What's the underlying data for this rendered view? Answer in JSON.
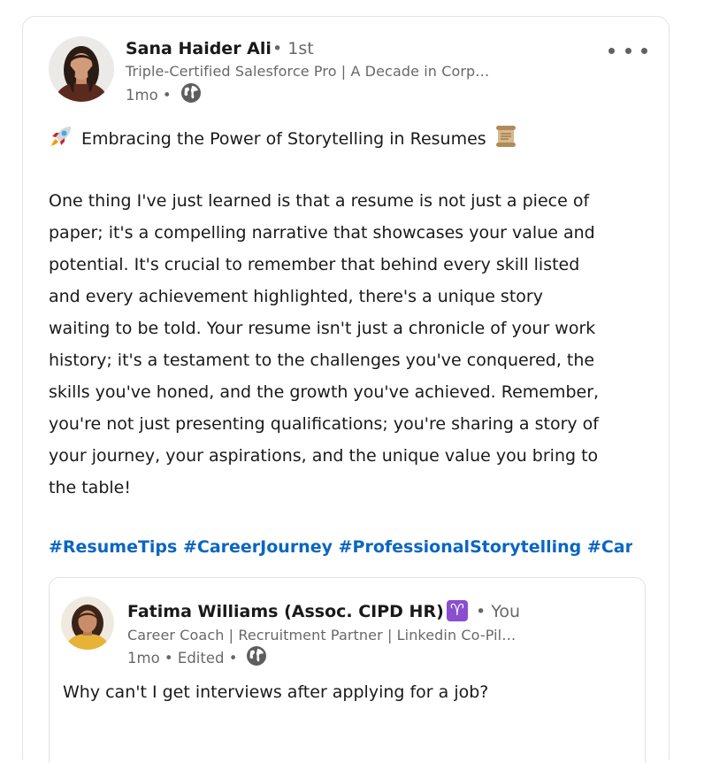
{
  "post": {
    "author": {
      "name": "Sana Haider Ali",
      "degree": "• 1st",
      "headline": "Triple-Certified Salesforce Pro | A Decade in Corp…",
      "time": "1mo •",
      "visibility_icon": "globe-icon"
    },
    "more_icon": "ellipsis-icon",
    "title": "Embracing the Power of Storytelling in Resumes",
    "title_emoji_start": "rocket-emoji",
    "title_emoji_end": "scroll-emoji",
    "body_lines": [
      "One thing I've just learned is that a resume is not just a piece of",
      "paper; it's a compelling narrative that showcases your value and",
      "potential. It's crucial to remember that behind every skill listed",
      "and every achievement highlighted, there's a unique story",
      "waiting to be told. Your resume isn't just a chronicle of your work",
      "history; it's a testament to the challenges you've conquered, the",
      "skills you've honed, and the growth you've achieved. Remember,",
      "you're not just presenting qualifications; you're sharing a story of",
      "your journey, your aspirations, and the unique value you bring to",
      "the table!"
    ],
    "hashtags": [
      "#ResumeTips",
      "#CareerJourney",
      "#ProfessionalStorytelling",
      "#Career"
    ]
  },
  "reshared": {
    "author": {
      "name": "Fatima Williams (Assoc. CIPD HR)",
      "sign_glyph": "♈",
      "relation": "• You",
      "headline": "Career Coach | Recruitment Partner | Linkedin Co-Pil…",
      "time": "1mo • Edited •",
      "visibility_icon": "globe-icon"
    },
    "text": "Why can't I get interviews after applying for a job?"
  },
  "colors": {
    "link": "#0a66c2",
    "muted_text": "#666666",
    "border": "#e3e3e3",
    "sign_badge": "#8a4fcf"
  }
}
